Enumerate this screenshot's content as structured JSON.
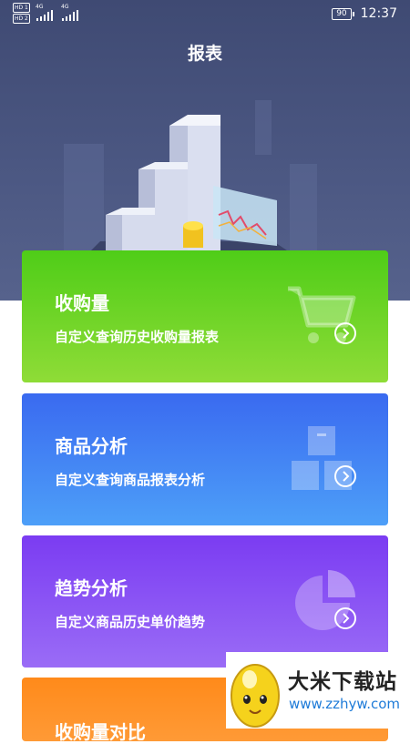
{
  "status_bar": {
    "sim1": "HD 1",
    "sim2": "HD 2",
    "network": "4G",
    "battery": "90",
    "time": "12:37"
  },
  "header": {
    "title": "报表"
  },
  "cards": [
    {
      "title": "收购量",
      "subtitle": "自定义查询历史收购量报表",
      "icon": "shopping-cart-icon",
      "color": "#4fcd18"
    },
    {
      "title": "商品分析",
      "subtitle": "自定义查询商品报表分析",
      "icon": "boxes-icon",
      "color": "#3a6af0"
    },
    {
      "title": "趋势分析",
      "subtitle": "自定义商品历史单价趋势",
      "icon": "pie-chart-icon",
      "color": "#7b3cf2"
    },
    {
      "title": "收购量对比",
      "icon": "",
      "color": "#ff8a1a"
    }
  ],
  "watermark": {
    "text": "大米下载站",
    "url": "www.zzhyw.com",
    "icon": "egg-mascot-icon"
  }
}
